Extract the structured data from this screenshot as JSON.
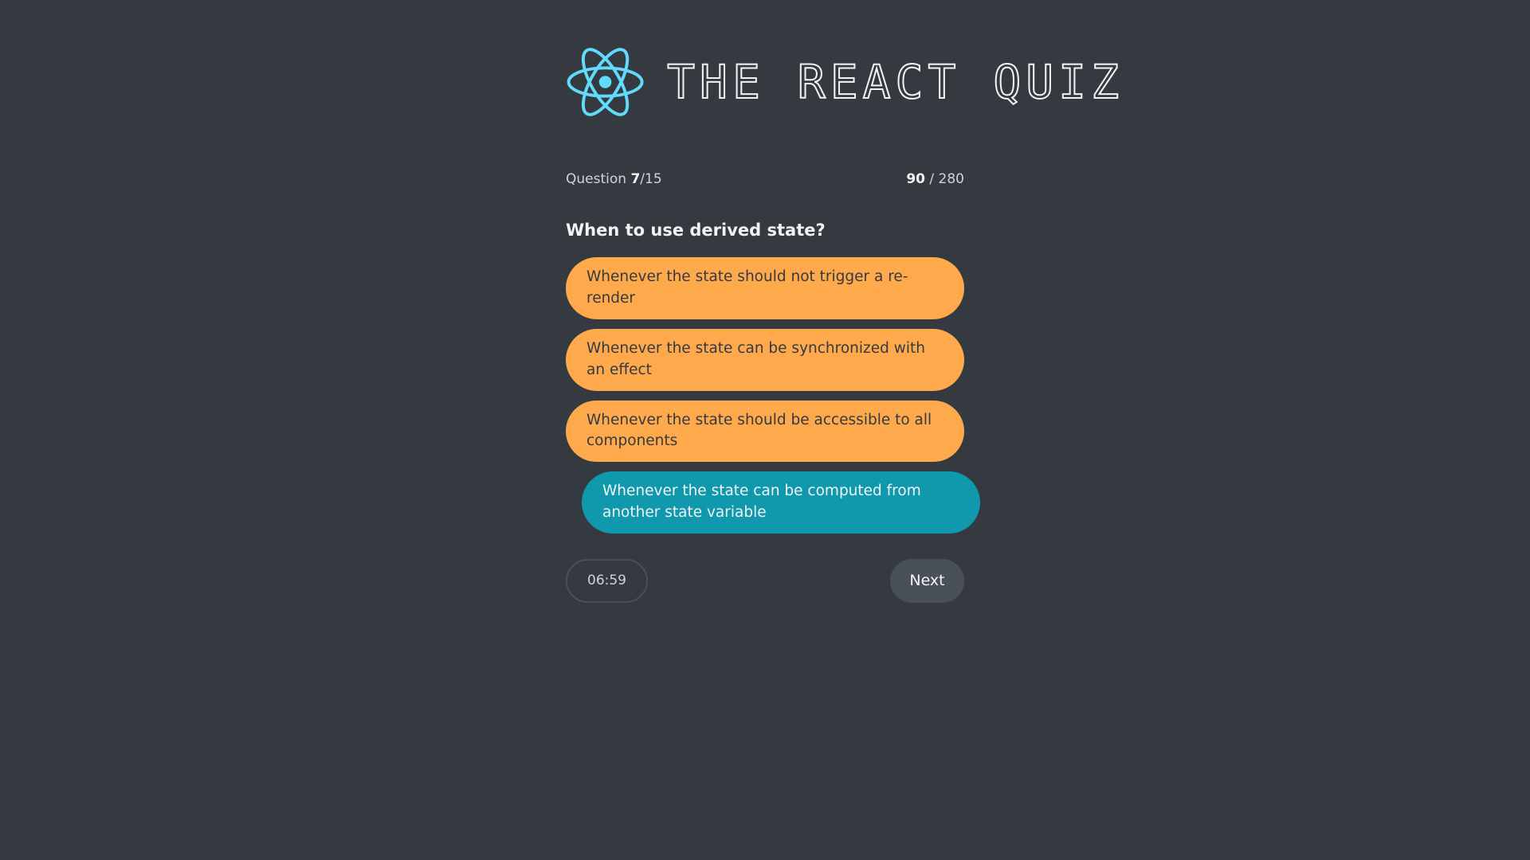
{
  "header": {
    "title": "THE REACT QUIZ",
    "logo_icon": "react-logo-icon"
  },
  "progress": {
    "label": "Question",
    "current": "7",
    "total": "/15",
    "points": "90",
    "max_points": "/ 280"
  },
  "question": {
    "text": "When to use derived state?",
    "options": [
      "Whenever the state should not trigger a re-render",
      "Whenever the state can be synchronized with an effect",
      "Whenever the state should be accessible to all components",
      "Whenever the state can be computed from another state variable"
    ],
    "selected_index": 3
  },
  "footer": {
    "timer": "06:59",
    "next_label": "Next"
  },
  "colors": {
    "background": "#343a40",
    "logo": "#61dafb",
    "option": "#ffa94d",
    "option_selected": "#1098ad",
    "button": "#495057"
  }
}
